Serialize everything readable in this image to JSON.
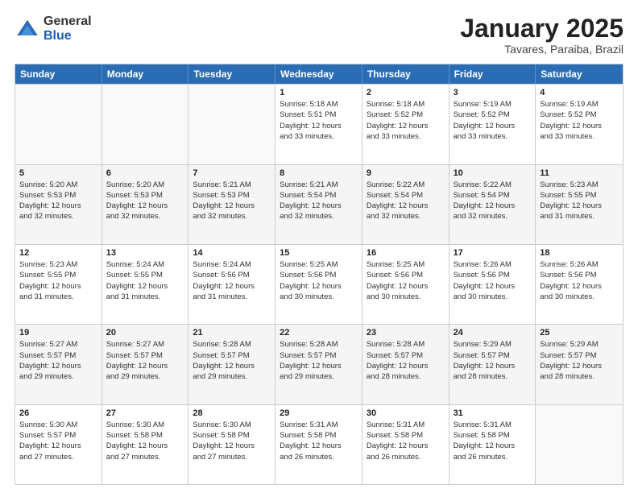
{
  "header": {
    "logo_general": "General",
    "logo_blue": "Blue",
    "month_title": "January 2025",
    "subtitle": "Tavares, Paraiba, Brazil"
  },
  "weekdays": [
    "Sunday",
    "Monday",
    "Tuesday",
    "Wednesday",
    "Thursday",
    "Friday",
    "Saturday"
  ],
  "rows": [
    [
      {
        "day": "",
        "info": ""
      },
      {
        "day": "",
        "info": ""
      },
      {
        "day": "",
        "info": ""
      },
      {
        "day": "1",
        "info": "Sunrise: 5:18 AM\nSunset: 5:51 PM\nDaylight: 12 hours\nand 33 minutes."
      },
      {
        "day": "2",
        "info": "Sunrise: 5:18 AM\nSunset: 5:52 PM\nDaylight: 12 hours\nand 33 minutes."
      },
      {
        "day": "3",
        "info": "Sunrise: 5:19 AM\nSunset: 5:52 PM\nDaylight: 12 hours\nand 33 minutes."
      },
      {
        "day": "4",
        "info": "Sunrise: 5:19 AM\nSunset: 5:52 PM\nDaylight: 12 hours\nand 33 minutes."
      }
    ],
    [
      {
        "day": "5",
        "info": "Sunrise: 5:20 AM\nSunset: 5:53 PM\nDaylight: 12 hours\nand 32 minutes."
      },
      {
        "day": "6",
        "info": "Sunrise: 5:20 AM\nSunset: 5:53 PM\nDaylight: 12 hours\nand 32 minutes."
      },
      {
        "day": "7",
        "info": "Sunrise: 5:21 AM\nSunset: 5:53 PM\nDaylight: 12 hours\nand 32 minutes."
      },
      {
        "day": "8",
        "info": "Sunrise: 5:21 AM\nSunset: 5:54 PM\nDaylight: 12 hours\nand 32 minutes."
      },
      {
        "day": "9",
        "info": "Sunrise: 5:22 AM\nSunset: 5:54 PM\nDaylight: 12 hours\nand 32 minutes."
      },
      {
        "day": "10",
        "info": "Sunrise: 5:22 AM\nSunset: 5:54 PM\nDaylight: 12 hours\nand 32 minutes."
      },
      {
        "day": "11",
        "info": "Sunrise: 5:23 AM\nSunset: 5:55 PM\nDaylight: 12 hours\nand 31 minutes."
      }
    ],
    [
      {
        "day": "12",
        "info": "Sunrise: 5:23 AM\nSunset: 5:55 PM\nDaylight: 12 hours\nand 31 minutes."
      },
      {
        "day": "13",
        "info": "Sunrise: 5:24 AM\nSunset: 5:55 PM\nDaylight: 12 hours\nand 31 minutes."
      },
      {
        "day": "14",
        "info": "Sunrise: 5:24 AM\nSunset: 5:56 PM\nDaylight: 12 hours\nand 31 minutes."
      },
      {
        "day": "15",
        "info": "Sunrise: 5:25 AM\nSunset: 5:56 PM\nDaylight: 12 hours\nand 30 minutes."
      },
      {
        "day": "16",
        "info": "Sunrise: 5:25 AM\nSunset: 5:56 PM\nDaylight: 12 hours\nand 30 minutes."
      },
      {
        "day": "17",
        "info": "Sunrise: 5:26 AM\nSunset: 5:56 PM\nDaylight: 12 hours\nand 30 minutes."
      },
      {
        "day": "18",
        "info": "Sunrise: 5:26 AM\nSunset: 5:56 PM\nDaylight: 12 hours\nand 30 minutes."
      }
    ],
    [
      {
        "day": "19",
        "info": "Sunrise: 5:27 AM\nSunset: 5:57 PM\nDaylight: 12 hours\nand 29 minutes."
      },
      {
        "day": "20",
        "info": "Sunrise: 5:27 AM\nSunset: 5:57 PM\nDaylight: 12 hours\nand 29 minutes."
      },
      {
        "day": "21",
        "info": "Sunrise: 5:28 AM\nSunset: 5:57 PM\nDaylight: 12 hours\nand 29 minutes."
      },
      {
        "day": "22",
        "info": "Sunrise: 5:28 AM\nSunset: 5:57 PM\nDaylight: 12 hours\nand 29 minutes."
      },
      {
        "day": "23",
        "info": "Sunrise: 5:28 AM\nSunset: 5:57 PM\nDaylight: 12 hours\nand 28 minutes."
      },
      {
        "day": "24",
        "info": "Sunrise: 5:29 AM\nSunset: 5:57 PM\nDaylight: 12 hours\nand 28 minutes."
      },
      {
        "day": "25",
        "info": "Sunrise: 5:29 AM\nSunset: 5:57 PM\nDaylight: 12 hours\nand 28 minutes."
      }
    ],
    [
      {
        "day": "26",
        "info": "Sunrise: 5:30 AM\nSunset: 5:57 PM\nDaylight: 12 hours\nand 27 minutes."
      },
      {
        "day": "27",
        "info": "Sunrise: 5:30 AM\nSunset: 5:58 PM\nDaylight: 12 hours\nand 27 minutes."
      },
      {
        "day": "28",
        "info": "Sunrise: 5:30 AM\nSunset: 5:58 PM\nDaylight: 12 hours\nand 27 minutes."
      },
      {
        "day": "29",
        "info": "Sunrise: 5:31 AM\nSunset: 5:58 PM\nDaylight: 12 hours\nand 26 minutes."
      },
      {
        "day": "30",
        "info": "Sunrise: 5:31 AM\nSunset: 5:58 PM\nDaylight: 12 hours\nand 26 minutes."
      },
      {
        "day": "31",
        "info": "Sunrise: 5:31 AM\nSunset: 5:58 PM\nDaylight: 12 hours\nand 26 minutes."
      },
      {
        "day": "",
        "info": ""
      }
    ]
  ]
}
